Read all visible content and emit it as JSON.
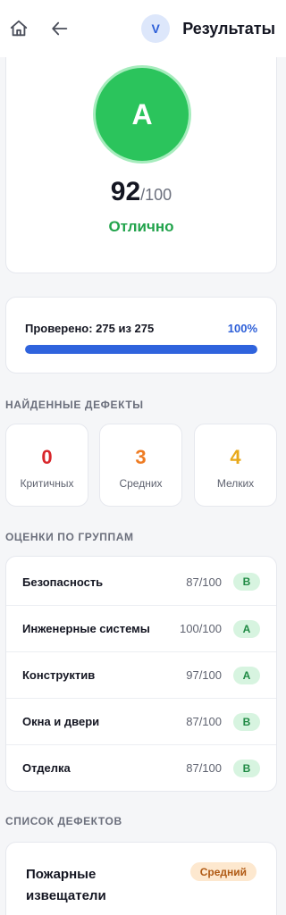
{
  "header": {
    "home_icon": "home-icon",
    "back_icon": "arrow-left-icon",
    "avatar_letter": "V",
    "title": "Результаты"
  },
  "score": {
    "grade": "A",
    "value": "92",
    "max": "/100",
    "label": "Отлично"
  },
  "progress": {
    "label": "Проверено: 275 из 275",
    "percent_text": "100%",
    "fraction": 1.0
  },
  "defects_section": {
    "title": "НАЙДЕННЫЕ ДЕФЕКТЫ",
    "items": [
      {
        "count": "0",
        "label": "Критичных",
        "color": "#d8262b"
      },
      {
        "count": "3",
        "label": "Средних",
        "color": "#ee7b22"
      },
      {
        "count": "4",
        "label": "Мелких",
        "color": "#e8a91a"
      }
    ]
  },
  "groups_section": {
    "title": "ОЦЕНКИ ПО ГРУППАМ",
    "items": [
      {
        "name": "Безопасность",
        "score": "87/100",
        "grade": "B"
      },
      {
        "name": "Инженерные системы",
        "score": "100/100",
        "grade": "A"
      },
      {
        "name": "Конструктив",
        "score": "97/100",
        "grade": "A"
      },
      {
        "name": "Окна и двери",
        "score": "87/100",
        "grade": "B"
      },
      {
        "name": "Отделка",
        "score": "87/100",
        "grade": "B"
      }
    ]
  },
  "defect_list": {
    "title": "СПИСОК ДЕФЕКТОВ",
    "items": [
      {
        "title": "Пожарные извещатели",
        "severity": "Средний"
      }
    ]
  },
  "colors": {
    "accent": "#2f63dd",
    "grade_circle": "#2bc45c",
    "success_text": "#21a34b"
  }
}
